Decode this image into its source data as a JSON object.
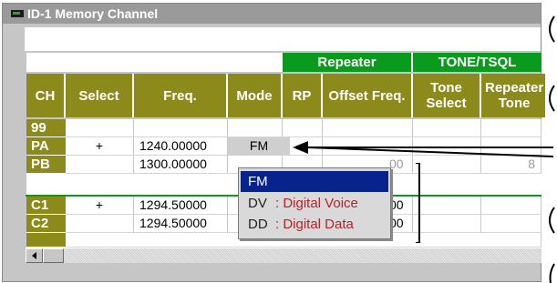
{
  "window": {
    "title": "ID-1 Memory Channel"
  },
  "header": {
    "group_repeater": "Repeater",
    "group_tone": "TONE/TSQL",
    "columns": {
      "ch": "CH",
      "select": "Select",
      "freq": "Freq.",
      "mode": "Mode",
      "rp": "RP",
      "offset_freq": "Offset Freq.",
      "tone_select": "Tone Select",
      "repeater_tone": "Repeater Tone"
    }
  },
  "rows": [
    {
      "ch": "99",
      "select": "",
      "freq": "",
      "mode": ""
    },
    {
      "ch": "PA",
      "select": "+",
      "freq": "1240.00000",
      "mode": "FM"
    },
    {
      "ch": "PB",
      "select": "",
      "freq": "1300.00000",
      "mode": ""
    },
    {
      "ch": "C1",
      "select": "+",
      "freq": "1294.50000",
      "mode": ""
    },
    {
      "ch": "C2",
      "select": "",
      "freq": "1294.50000",
      "mode": ""
    }
  ],
  "partial_offset_values": [
    "00",
    "00",
    "00"
  ],
  "partial_tone_values": [
    "8"
  ],
  "mode_dropdown": {
    "selected": "FM",
    "options": [
      {
        "code": "FM",
        "description": ""
      },
      {
        "code": "DV",
        "description": ": Digital Voice"
      },
      {
        "code": "DD",
        "description": ": Digital Data"
      }
    ]
  },
  "colors": {
    "header_green": "#0a9a1e",
    "header_olive": "#8c8a1a",
    "dropdown_selection": "#08248c",
    "description_text": "#b0242c"
  },
  "icons": {
    "app": "memory-channel-app-icon",
    "scroll_left": "scroll-left-arrow-icon",
    "callout_arrow": "callout-arrow-icon"
  }
}
